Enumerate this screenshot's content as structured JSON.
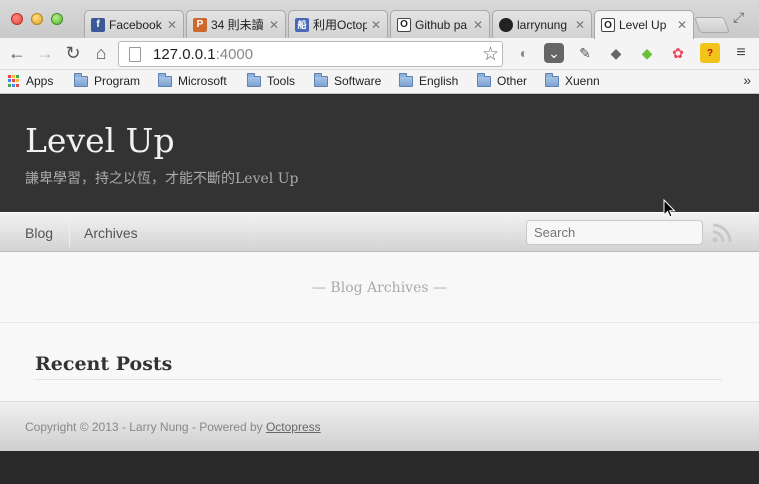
{
  "browser": {
    "tabs": [
      {
        "title": "Facebook",
        "favicon": "facebook-icon",
        "favicon_color": "#3b5998",
        "favicon_glyph": "f"
      },
      {
        "title": "34 則未讀",
        "favicon": "plurk-icon",
        "favicon_color": "#cf682f",
        "favicon_glyph": "P"
      },
      {
        "title": "利用Octop",
        "favicon": "blog-icon",
        "favicon_color": "#4a67b8",
        "favicon_glyph": "船"
      },
      {
        "title": "Github pa",
        "favicon": "octopress-icon",
        "favicon_color": "#444444",
        "favicon_glyph": "O"
      },
      {
        "title": "larrynung",
        "favicon": "github-icon",
        "favicon_color": "#222222",
        "favicon_glyph": "●"
      },
      {
        "title": "Level Up",
        "favicon": "octopress-icon",
        "favicon_color": "#444444",
        "favicon_glyph": "O"
      }
    ],
    "address": {
      "host": "127.0.0.1",
      "port": ":4000"
    },
    "bookmarks": {
      "apps": "Apps",
      "folders": [
        "Program",
        "Microsoft",
        "Tools",
        "Software",
        "English",
        "Other",
        "Xuenn"
      ]
    }
  },
  "site": {
    "title": "Level Up",
    "subtitle": "謙卑學習，持之以恆，才能不斷的Level Up",
    "nav": {
      "blog": "Blog",
      "archives": "Archives"
    },
    "search_placeholder": "Search",
    "archive_heading": "— Blog Archives —",
    "recent_posts": "Recent Posts",
    "footer": {
      "text": "Copyright © 2013 - Larry Nung - Powered by ",
      "link": "Octopress"
    }
  },
  "colors": {
    "header_bg": "#333333",
    "accent": "#3b5998"
  }
}
